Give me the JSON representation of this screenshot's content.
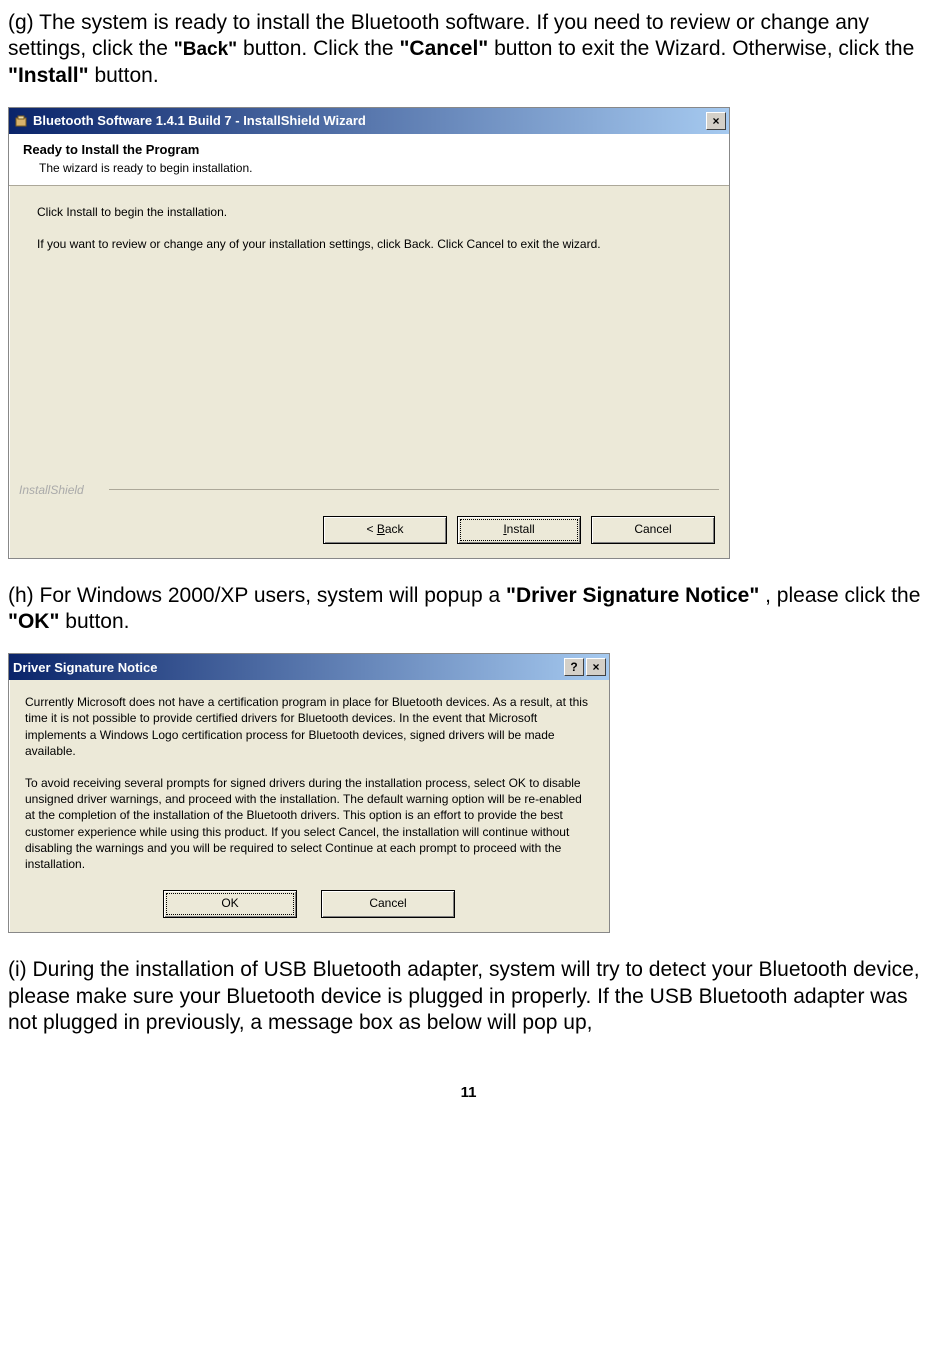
{
  "para_g": {
    "p1a": "(g) The system is ready to install the Bluetooth software. If you need to review or change any settings, click the ",
    "b1": "\"Back\"",
    "p1b": " button. Click the ",
    "b2": "\"Cancel\"",
    "p1c": " button to exit the Wizard. Otherwise, click the ",
    "b3": "\"Install\"",
    "p1d": " button."
  },
  "dlg1": {
    "title": "Bluetooth Software 1.4.1 Build 7 - InstallShield Wizard",
    "close": "×",
    "htitle": "Ready to Install the Program",
    "hsub": "The wizard is ready to begin installation.",
    "body1": "Click Install to begin the installation.",
    "body2": "If you want to review or change any of your installation settings, click Back. Click Cancel to exit the wizard.",
    "brand": "InstallShield",
    "btn_back_pre": "< ",
    "btn_back_letter": "B",
    "btn_back_post": "ack",
    "btn_install_pre": "",
    "btn_install_letter": "I",
    "btn_install_post": "nstall",
    "btn_cancel": "Cancel"
  },
  "para_h": {
    "p1a": "(h) For Windows 2000/XP users, system will popup a ",
    "b1": "\"Driver Signature Notice\"",
    "p1b": ", please click the ",
    "b2": "\"OK\"",
    "p1c": " button."
  },
  "dlg2": {
    "title": "Driver Signature Notice",
    "help": "?",
    "close": "×",
    "body1": "Currently Microsoft does not have a certification program in place for Bluetooth devices. As a result, at this time it is not possible to provide certified drivers for Bluetooth devices.  In the event that Microsoft implements a Windows Logo certification process for Bluetooth devices, signed drivers will be made available.",
    "body2": "To avoid receiving several prompts for signed drivers during the installation process, select OK to disable unsigned driver warnings, and proceed with the installation. The default warning option will be re-enabled at the completion of the installation of the Bluetooth drivers. This option is an effort to provide the best customer experience while using this product. If you select Cancel, the installation will continue without disabling the warnings and you will be required to select Continue at each prompt to proceed with the installation.",
    "btn_ok": "OK",
    "btn_cancel": "Cancel"
  },
  "para_i": "(i) During the installation of USB Bluetooth adapter, system will try to detect your Bluetooth device, please make sure your Bluetooth device is plugged in properly. If the USB Bluetooth adapter was not plugged in previously, a message box as below will pop up,",
  "page_number": "11"
}
